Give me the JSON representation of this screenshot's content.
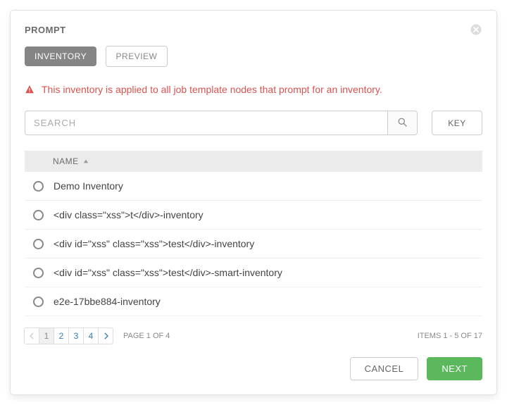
{
  "title": "PROMPT",
  "tabs": {
    "inventory": "INVENTORY",
    "preview": "PREVIEW"
  },
  "warning_text": "This inventory is applied to all job template nodes that prompt for an inventory.",
  "search": {
    "placeholder": "SEARCH",
    "key_label": "KEY"
  },
  "table": {
    "header_name": "NAME",
    "rows": [
      "Demo Inventory",
      "<div class=\"xss\">t</div>-inventory",
      "<div id=\"xss\" class=\"xss\">test</div>-inventory",
      "<div id=\"xss\" class=\"xss\">test</div>-smart-inventory",
      "e2e-17bbe884-inventory"
    ]
  },
  "pagination": {
    "pages": [
      "1",
      "2",
      "3",
      "4"
    ],
    "current": "1",
    "page_of": "PAGE 1 OF 4",
    "items_of": "ITEMS  1 - 5 OF 17"
  },
  "footer": {
    "cancel": "CANCEL",
    "next": "NEXT"
  }
}
